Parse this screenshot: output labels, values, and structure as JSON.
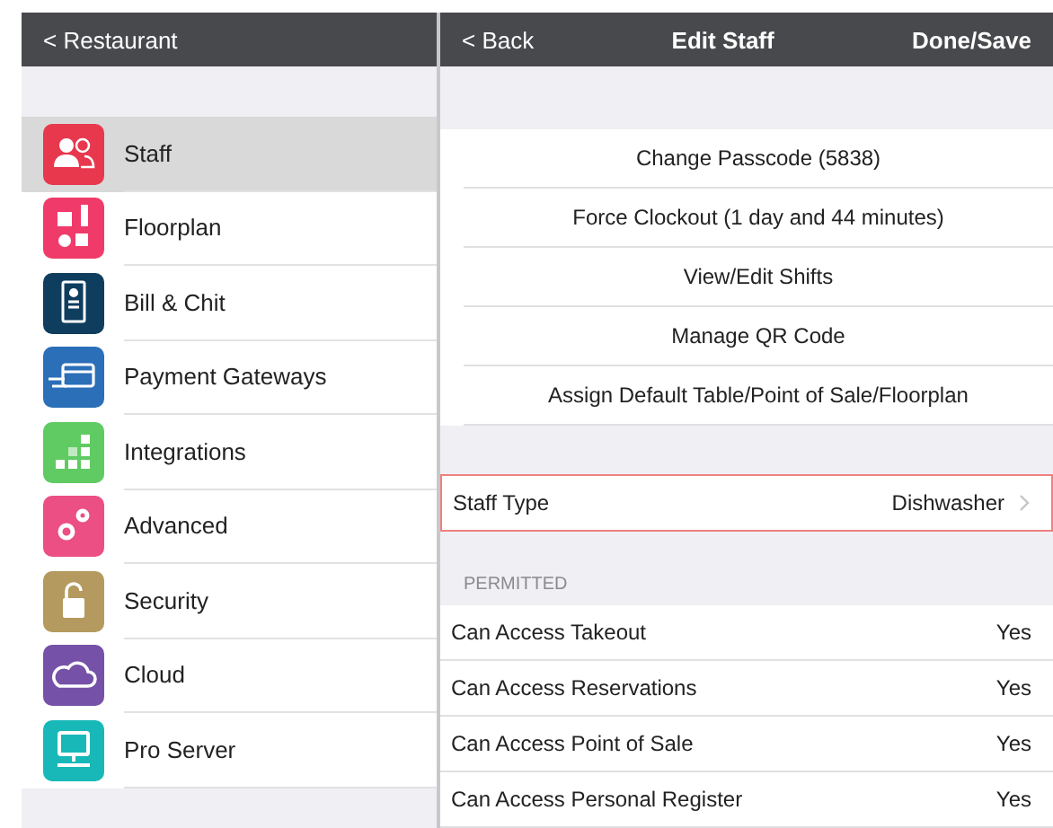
{
  "sidebar": {
    "back_label": "< Restaurant",
    "items": [
      {
        "label": "Staff",
        "kind": "staff",
        "color": "#e8384d",
        "selected": true
      },
      {
        "label": "Floorplan",
        "kind": "floorplan",
        "color": "#ef3a6a",
        "selected": false
      },
      {
        "label": "Bill & Chit",
        "kind": "bill",
        "color": "#0f3d5e",
        "selected": false
      },
      {
        "label": "Payment Gateways",
        "kind": "payment",
        "color": "#2a6fb8",
        "selected": false
      },
      {
        "label": "Integrations",
        "kind": "integrations",
        "color": "#5fcb62",
        "selected": false
      },
      {
        "label": "Advanced",
        "kind": "advanced",
        "color": "#ec4f84",
        "selected": false
      },
      {
        "label": "Security",
        "kind": "security",
        "color": "#b49a5e",
        "selected": false
      },
      {
        "label": "Cloud",
        "kind": "cloud",
        "color": "#7552a8",
        "selected": false
      },
      {
        "label": "Pro Server",
        "kind": "server",
        "color": "#19b8b8",
        "selected": false
      }
    ]
  },
  "detail": {
    "back_label": "< Back",
    "title": "Edit Staff",
    "done_label": "Done/Save",
    "actions": [
      "Change Passcode (5838)",
      "Force Clockout (1 day and 44 minutes)",
      "View/Edit Shifts",
      "Manage QR Code",
      "Assign Default Table/Point of Sale/Floorplan"
    ],
    "staff_type": {
      "label": "Staff Type",
      "value": "Dishwasher",
      "highlighted": true
    },
    "permitted": {
      "heading": "PERMITTED",
      "rows": [
        {
          "label": "Can Access Takeout",
          "value": "Yes"
        },
        {
          "label": "Can Access Reservations",
          "value": "Yes"
        },
        {
          "label": "Can Access Point of Sale",
          "value": "Yes"
        },
        {
          "label": "Can Access Personal Register",
          "value": "Yes"
        }
      ]
    }
  }
}
